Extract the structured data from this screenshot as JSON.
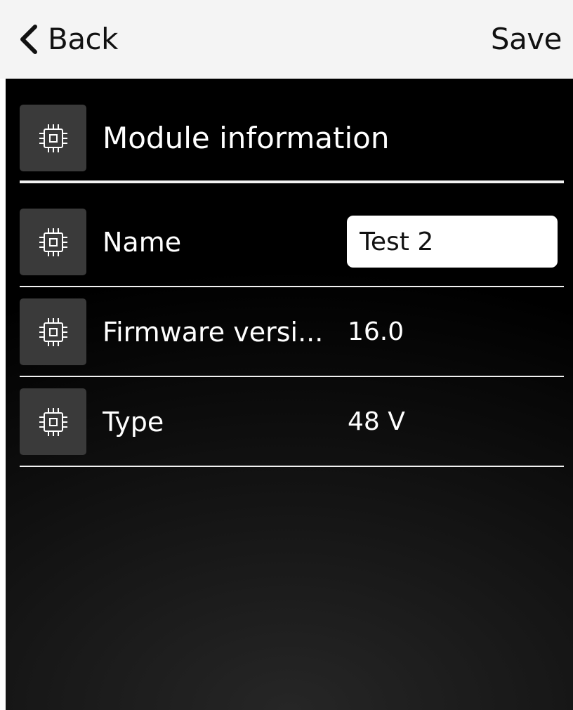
{
  "header": {
    "back_label": "Back",
    "back_icon": "chevron-left-icon",
    "save_label": "Save"
  },
  "section": {
    "title": "Module information",
    "icon": "chip-icon"
  },
  "fields": {
    "name": {
      "label": "Name",
      "value": "Test 2",
      "icon": "chip-icon"
    },
    "firmware": {
      "label": "Firmware versi...",
      "value": "16.0",
      "icon": "chip-icon"
    },
    "type": {
      "label": "Type",
      "value": "48 V",
      "icon": "chip-icon"
    }
  },
  "colors": {
    "topbar_bg": "#f4f4f4",
    "content_bg": "#000000",
    "tile_bg": "#3a3a3a",
    "text_light": "#ffffff",
    "text_dark": "#111111",
    "divider": "#f2f2f2"
  }
}
